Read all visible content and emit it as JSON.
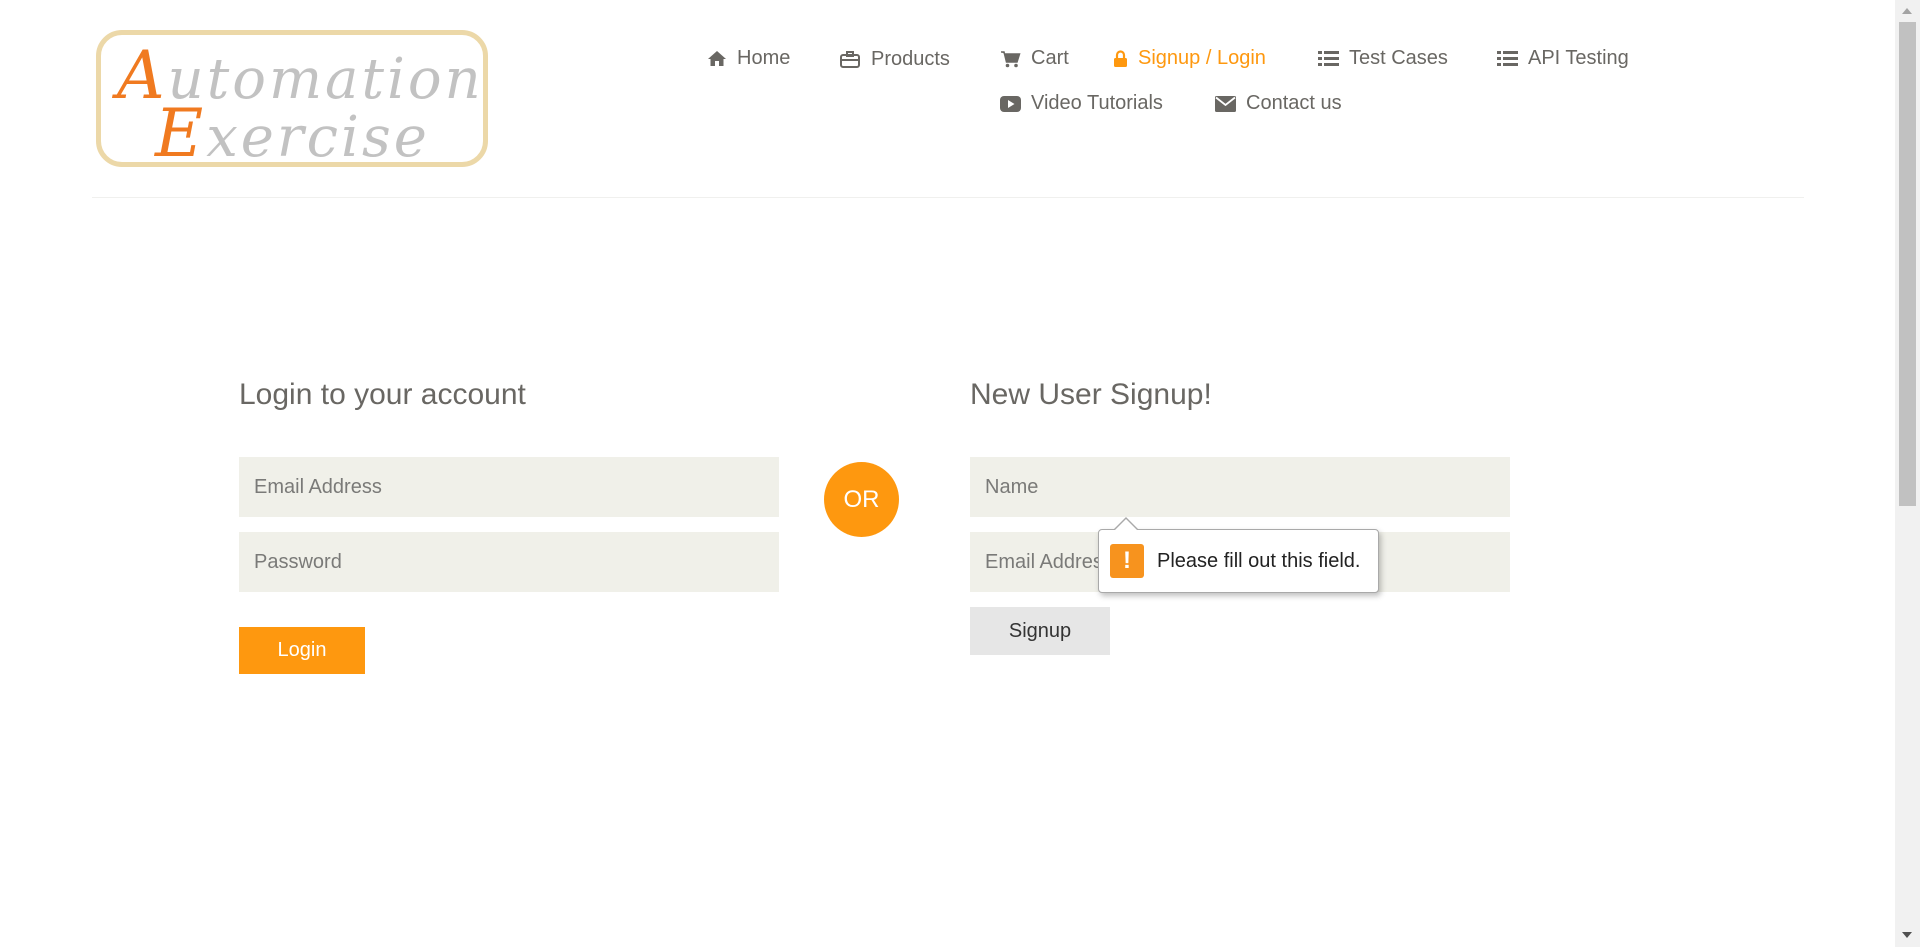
{
  "logo": {
    "line1_cap": "A",
    "line1_rest": "utomation",
    "line2_cap": "E",
    "line2_rest": "xercise"
  },
  "nav": {
    "home": "Home",
    "products": "Products",
    "cart": "Cart",
    "signup_login": "Signup / Login",
    "test_cases": "Test Cases",
    "api_testing": "API Testing",
    "video_tutorials": "Video Tutorials",
    "contact_us": "Contact us"
  },
  "login": {
    "title": "Login to your account",
    "email_placeholder": "Email Address",
    "password_placeholder": "Password",
    "button": "Login"
  },
  "or_label": "OR",
  "signup": {
    "title": "New User Signup!",
    "name_placeholder": "Name",
    "email_placeholder": "Email Address",
    "button": "Signup"
  },
  "validation_tooltip": {
    "icon": "!",
    "message": "Please fill out this field."
  },
  "colors": {
    "accent": "#fe980f",
    "text": "#696763",
    "field_bg": "#f0f0e9"
  }
}
